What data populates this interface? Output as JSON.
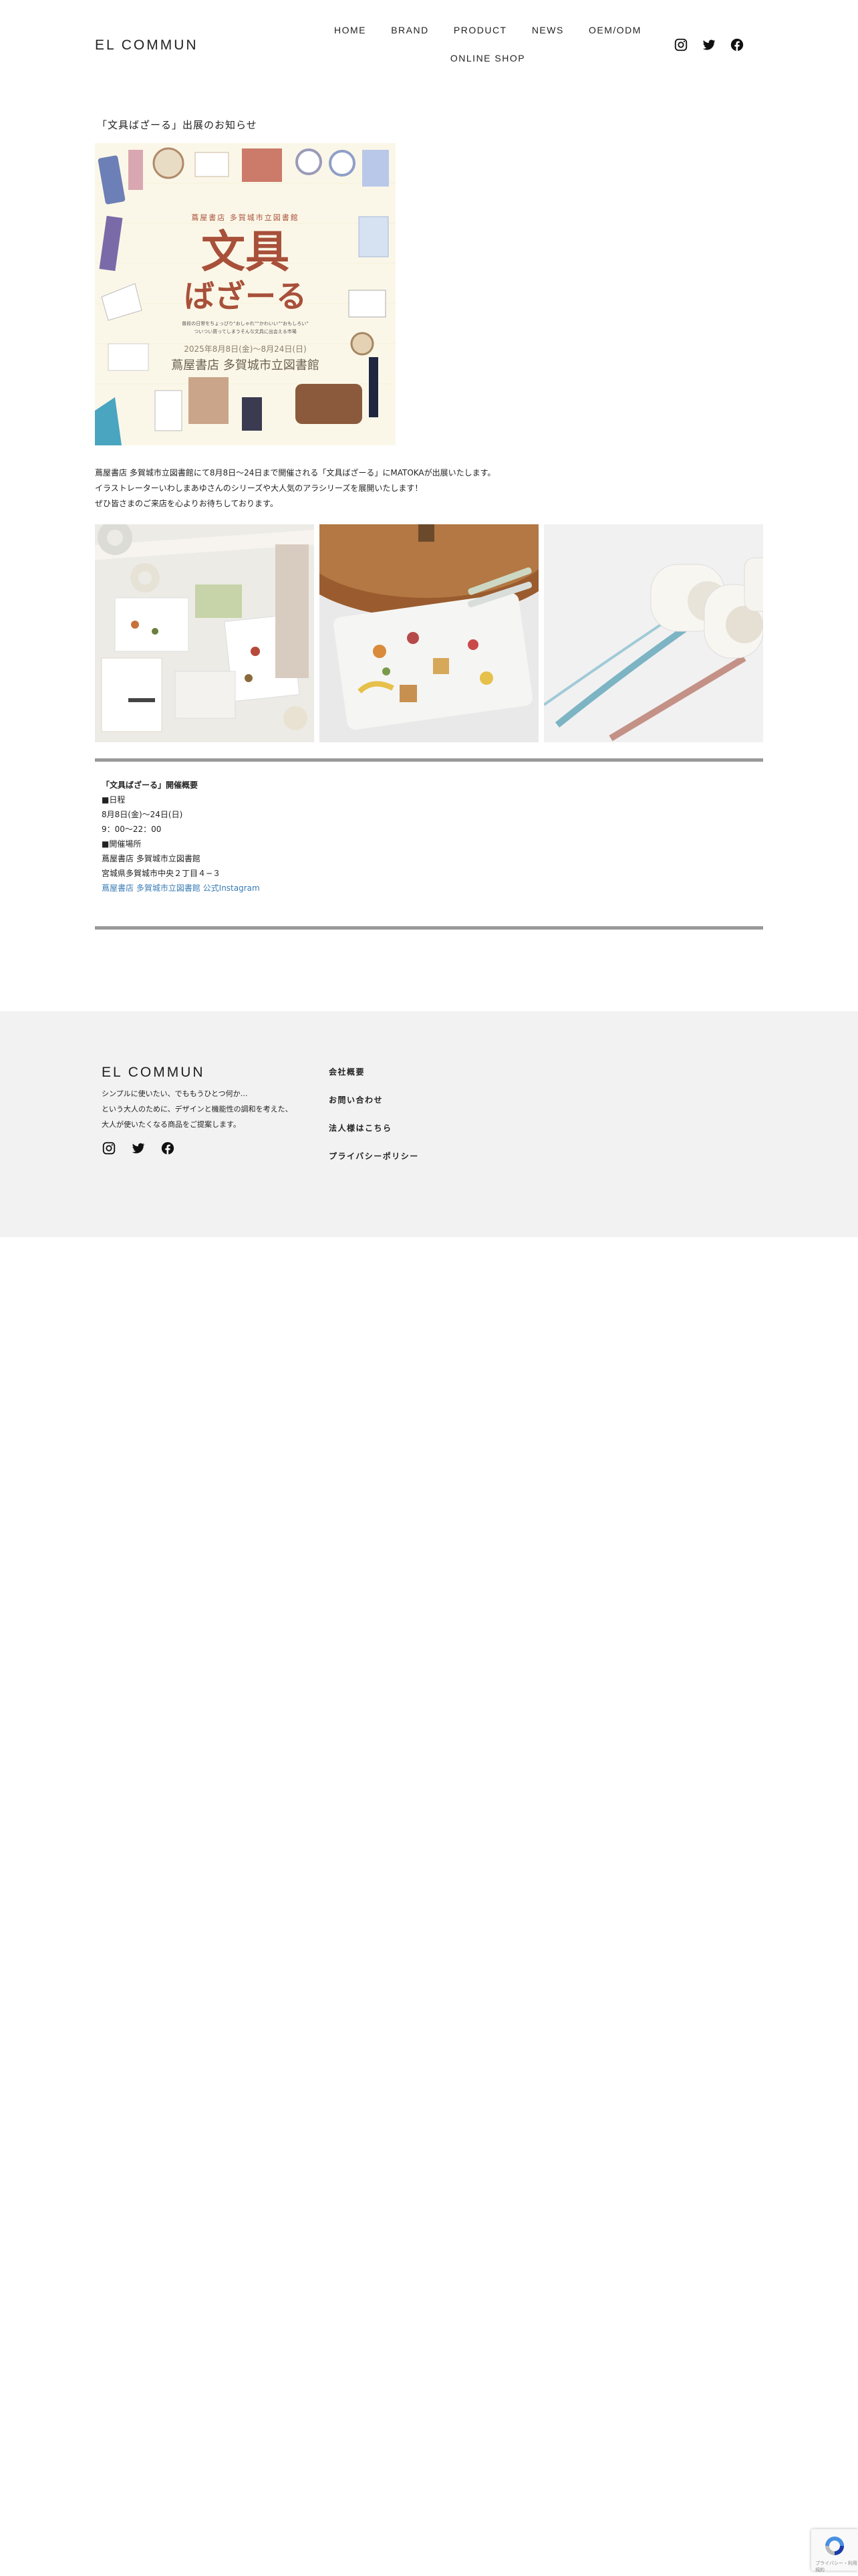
{
  "header": {
    "logo": "EL COMMUN",
    "nav": [
      "HOME",
      "BRAND",
      "PRODUCT",
      "NEWS",
      "OEM/ODM"
    ],
    "nav_row2": "ONLINE SHOP",
    "social_icons": [
      "instagram-icon",
      "twitter-icon",
      "facebook-icon"
    ]
  },
  "article": {
    "title": "「文具ばざーる」出展のお知らせ",
    "poster": {
      "label": "蔦屋書店 多賀城市立図書館",
      "heading_line1": "文具",
      "heading_line2": "ばざーる",
      "tagline_line1": "普段の日常をちょっぴり“おしゃれ”“かわいい”“おもしろい”",
      "tagline_line2": "ついつい買ってしまうそんな文具に出会える市場",
      "dates": "2025年8月8日(金)〜8月24日(日)",
      "venue": "蔦屋書店 多賀城市立図書館"
    },
    "intro": [
      "蔦屋書店 多賀城市立図書館にて8月8日〜24日まで開催される「文具ばざーる」にMATOKAが出展いたします。",
      "イラストレーターいわしまあゆさんのシリーズや大人気のアラシリーズを展開いたします！",
      "ぜひ皆さまのご来店を心よりお待ちしております。"
    ]
  },
  "info": {
    "heading": "「文具ばざーる」開催概要",
    "date_label": "■日程",
    "date_value": "8月8日(金)〜24日(日)",
    "time_value": "9：00〜22：00",
    "place_label": "■開催場所",
    "place_name": "蔦屋書店 多賀城市立図書館",
    "address": "宮城県多賀城市中央２丁目４−３",
    "link1": "蔦屋書店 多賀城市立図書館",
    "link2": "公式Instagram"
  },
  "footer": {
    "logo": "EL COMMUN",
    "desc": [
      "シンプルに使いたい、でももうひとつ何か…",
      "という大人のために、デザインと機能性の調和を考えた、",
      "大人が使いたくなる商品をご提案します。"
    ],
    "links": [
      "会社概要",
      "お問い合わせ",
      "法人様はこちら",
      "プライバシーポリシー"
    ]
  },
  "recaptcha": {
    "text": "プライバシー・利用規約"
  },
  "colors": {
    "footer_bg": "#f2f2f2",
    "link": "#3a7cb5",
    "rule": "#999999",
    "poster_title": "#a8503a"
  }
}
